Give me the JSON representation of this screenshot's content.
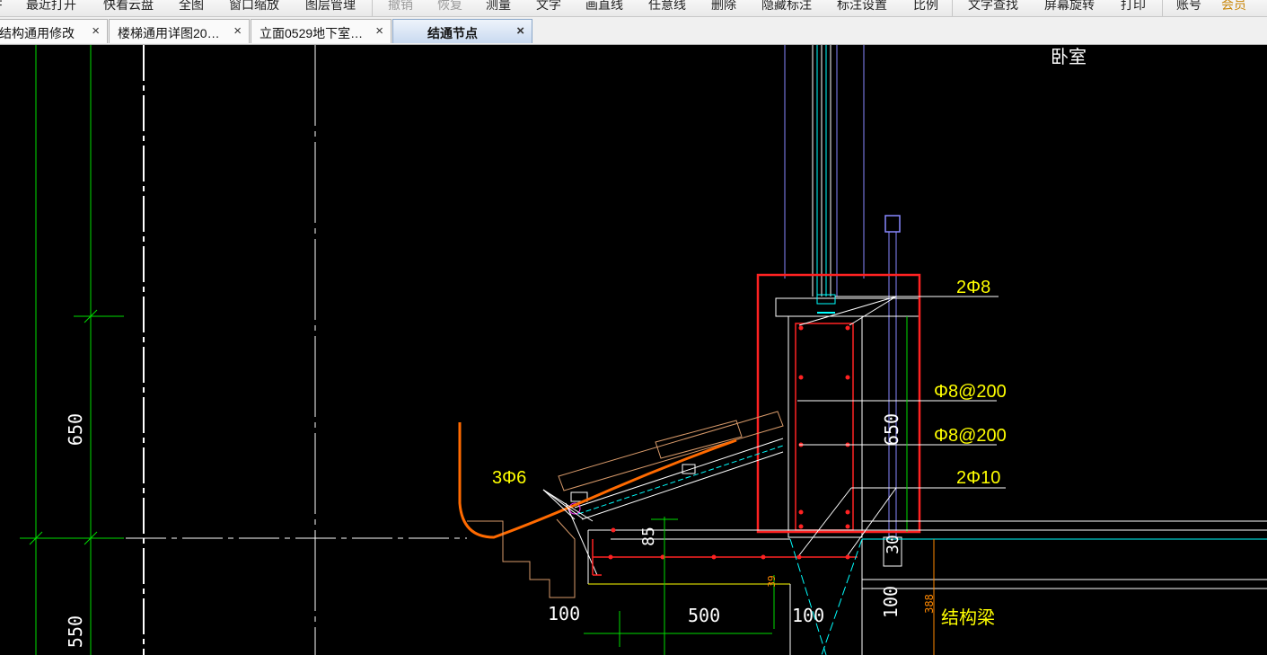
{
  "toolbar": {
    "items": [
      {
        "label": "最近打开",
        "enabled": true
      },
      {
        "label": "快看云盘",
        "enabled": true
      },
      {
        "label": "全图",
        "enabled": true
      },
      {
        "label": "窗口缩放",
        "enabled": true
      },
      {
        "label": "图层管理",
        "enabled": true
      },
      {
        "label": "撤销",
        "enabled": false
      },
      {
        "label": "恢复",
        "enabled": false
      },
      {
        "label": "测量",
        "enabled": true
      },
      {
        "label": "文字",
        "enabled": true
      },
      {
        "label": "画直线",
        "enabled": true
      },
      {
        "label": "任意线",
        "enabled": true
      },
      {
        "label": "删除",
        "enabled": true
      },
      {
        "label": "隐藏标注",
        "enabled": true
      },
      {
        "label": "标注设置",
        "enabled": true
      },
      {
        "label": "比例",
        "enabled": true
      },
      {
        "label": "文字查找",
        "enabled": true
      },
      {
        "label": "屏幕旋转",
        "enabled": true
      },
      {
        "label": "打印",
        "enabled": true
      },
      {
        "label": "账号",
        "enabled": true
      },
      {
        "label": "会员",
        "enabled": true
      }
    ]
  },
  "tabs": [
    {
      "label": "结构通用修改",
      "active": false
    },
    {
      "label": "楼梯通用详图20…",
      "active": false
    },
    {
      "label": "立面0529地下室…",
      "active": false
    },
    {
      "label": "结通节点",
      "active": true
    }
  ],
  "close_glyph": "×",
  "drawing": {
    "room_label": "卧室",
    "dims": {
      "left_650": "650",
      "left_550": "550",
      "node_650": "650",
      "d85": "85",
      "d30": "30",
      "d100_a": "100",
      "d500": "500",
      "d100_b": "100",
      "d100_c": "100",
      "d388": "388",
      "d39": "39"
    },
    "rebar": {
      "top": "2Φ8",
      "stirrup_1": "Φ8@200",
      "stirrup_2": "Φ8@200",
      "bottom": "2Φ10",
      "eave": "3Φ6"
    },
    "beam_label": "结构梁"
  },
  "colors": {
    "background": "#000000",
    "highlight_box": "#ff2222",
    "annotation": "#ffff00",
    "dimension": "#00ff00",
    "gutter": "#ff6a00",
    "pipe": "#7a7aff"
  }
}
